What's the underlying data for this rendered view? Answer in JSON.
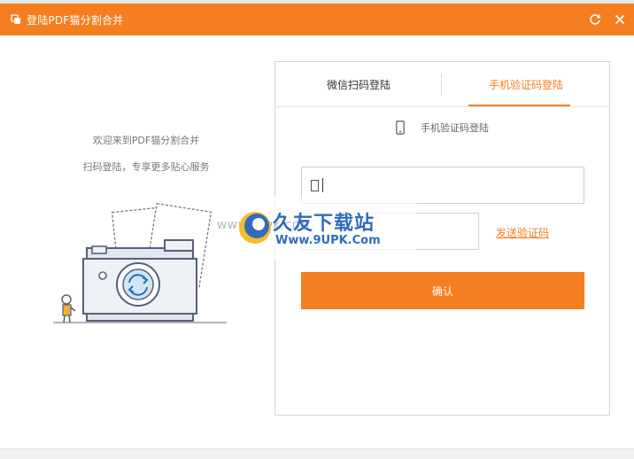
{
  "window": {
    "title": "登陆PDF猫分割合并",
    "icons": {
      "app": "app-logo-icon",
      "refresh": "refresh-icon",
      "close": "close-icon"
    }
  },
  "left": {
    "welcome_line1": "欢迎来到PDF猫分割合并",
    "welcome_line2": "扫码登陆，专享更多贴心服务",
    "illustration": "camera-illustration"
  },
  "login": {
    "tabs": [
      {
        "label": "微信扫码登陆",
        "active": false
      },
      {
        "label": "手机验证码登陆",
        "active": true
      }
    ],
    "sub_heading": "手机验证码登陆",
    "phone_input": {
      "value": "",
      "placeholder": ""
    },
    "code_input": {
      "value": "",
      "placeholder": ""
    },
    "send_code_label": "发送验证码",
    "confirm_label": "确认"
  },
  "watermark": {
    "brand_cn": "久友下载站",
    "brand_en": "Www.9UPK.Com",
    "url_side": "WWW.9UPK.COM"
  },
  "colors": {
    "accent": "#f57f20",
    "watermark_blue": "#1f5fb8"
  }
}
